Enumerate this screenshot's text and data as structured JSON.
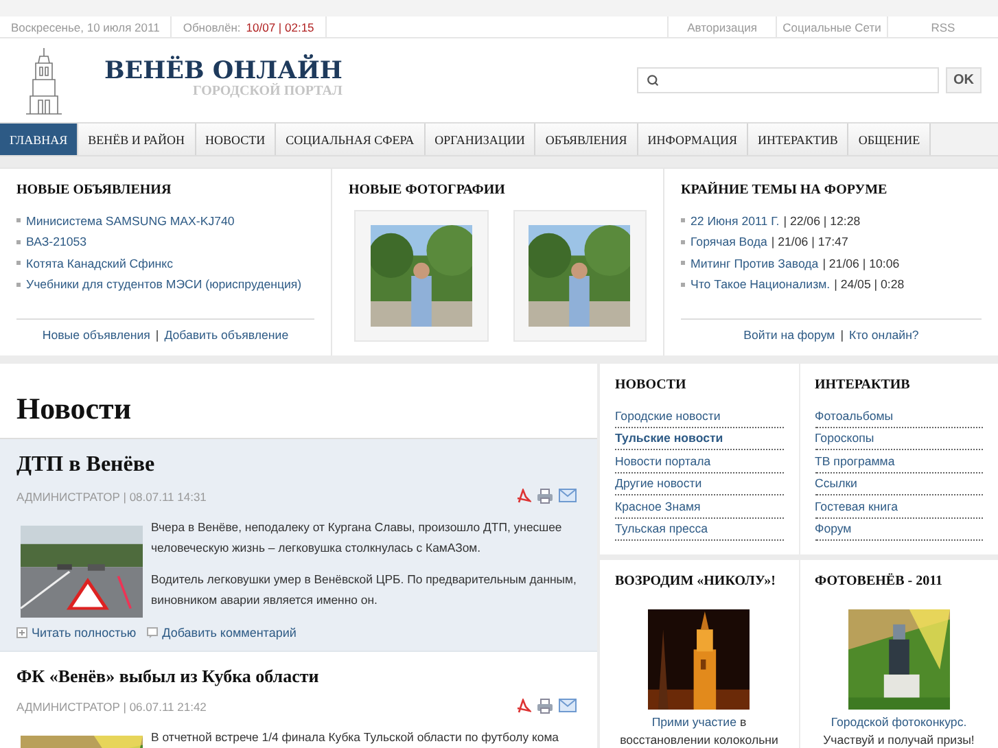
{
  "top_bar": {
    "date": "Воскресенье, 10 июля 2011",
    "updated_label": "Обновлён:",
    "updated_value": "10/07 | 02:15",
    "links": [
      "Авторизация",
      "Социальные Сети",
      "RSS"
    ]
  },
  "header": {
    "title": "ВЕНЁВ ОНЛАЙН",
    "subtitle": "ГОРОДСКОЙ ПОРТАЛ",
    "search_button": "OK"
  },
  "nav": [
    {
      "label": "ГЛАВНАЯ",
      "selected": true
    },
    {
      "label": "ВЕНЁВ И РАЙОН",
      "selected": false
    },
    {
      "label": "НОВОСТИ",
      "selected": false
    },
    {
      "label": "СОЦИАЛЬНАЯ СФЕРА",
      "selected": false
    },
    {
      "label": "ОРГАНИЗАЦИИ",
      "selected": false
    },
    {
      "label": "ОБЪЯВЛЕНИЯ",
      "selected": false
    },
    {
      "label": "ИНФОРМАЦИЯ",
      "selected": false
    },
    {
      "label": "ИНТЕРАКТИВ",
      "selected": false
    },
    {
      "label": "ОБЩЕНИЕ",
      "selected": false
    }
  ],
  "ads": {
    "title": "НОВЫЕ ОБЪЯВЛЕНИЯ",
    "items": [
      "Минисистема SAMSUNG MAX-KJ740",
      "ВАЗ-21053",
      "Котята Канадский Сфинкс",
      "Учебники для студентов МЭСИ (юриспруденция)"
    ],
    "links": [
      "Новые объявления",
      "Добавить объявление"
    ],
    "separator": "|"
  },
  "photos": {
    "title": "НОВЫЕ ФОТОГРАФИИ"
  },
  "forum": {
    "title": "КРАЙНИЕ ТЕМЫ НА ФОРУМЕ",
    "topics": [
      {
        "title": "22 Июня 2011 Г.",
        "meta": "| 22/06 | 12:28"
      },
      {
        "title": "Горячая Вода",
        "meta": "| 21/06 | 17:47"
      },
      {
        "title": "Митинг Против Завода",
        "meta": "| 21/06 | 10:06"
      },
      {
        "title": "Что Такое Национализм.",
        "meta": "| 24/05 | 0:28"
      }
    ],
    "links": [
      "Войти на форум",
      "Кто онлайн?"
    ],
    "separator": "|"
  },
  "news": {
    "heading": "Новости",
    "articles": [
      {
        "title": "ДТП в Венёве",
        "meta": "АДМИНИСТРАТОР | 08.07.11 14:31",
        "highlighted": true,
        "paragraphs": [
          "Вчера в Венёве, неподалеку от  Кургана Славы, произошло ДТП, унесшее человеческую жизнь – легковушка столкнулась с КамАЗом.",
          "Водитель легковушки умер в Венёвской ЦРБ. По предварительным данным, виновником аварии является именно он."
        ],
        "links": [
          "Читать полностью",
          "Добавить комментарий"
        ]
      },
      {
        "title": "ФК «Венёв» выбыл из Кубка области",
        "meta": "АДМИНИСТРАТОР | 06.07.11 21:42",
        "highlighted": false,
        "paragraphs": [
          "В отчетной встрече 1/4 финала Кубка Тульской области по футболу кома"
        ]
      }
    ]
  },
  "sidebar_news": {
    "title": "НОВОСТИ",
    "items": [
      {
        "label": "Городские новости",
        "selected": false
      },
      {
        "label": "Тульские новости",
        "selected": true
      },
      {
        "label": "Новости портала",
        "selected": false
      },
      {
        "label": "Другие новости",
        "selected": false
      },
      {
        "label": "Красное Знамя",
        "selected": false
      },
      {
        "label": "Тульская пресса",
        "selected": false
      }
    ]
  },
  "sidebar_interactive": {
    "title": "ИНТЕРАКТИВ",
    "items": [
      {
        "label": "Фотоальбомы",
        "selected": false
      },
      {
        "label": "Гороскопы",
        "selected": false
      },
      {
        "label": "ТВ программа",
        "selected": false
      },
      {
        "label": "Ссылки",
        "selected": false
      },
      {
        "label": "Гостевая книга",
        "selected": false
      },
      {
        "label": "Форум",
        "selected": false
      }
    ]
  },
  "promos": [
    {
      "kind": "tower",
      "title": "ВОЗРОДИМ «НИКОЛУ»!",
      "link": "Прими участие",
      "text": "в восстановлении колокольни"
    },
    {
      "kind": "monument",
      "title": "ФОТОВЕНЁВ - 2011",
      "link": "Городской фотоконкурс.",
      "text": "Участвуй и получай призы!"
    }
  ]
}
